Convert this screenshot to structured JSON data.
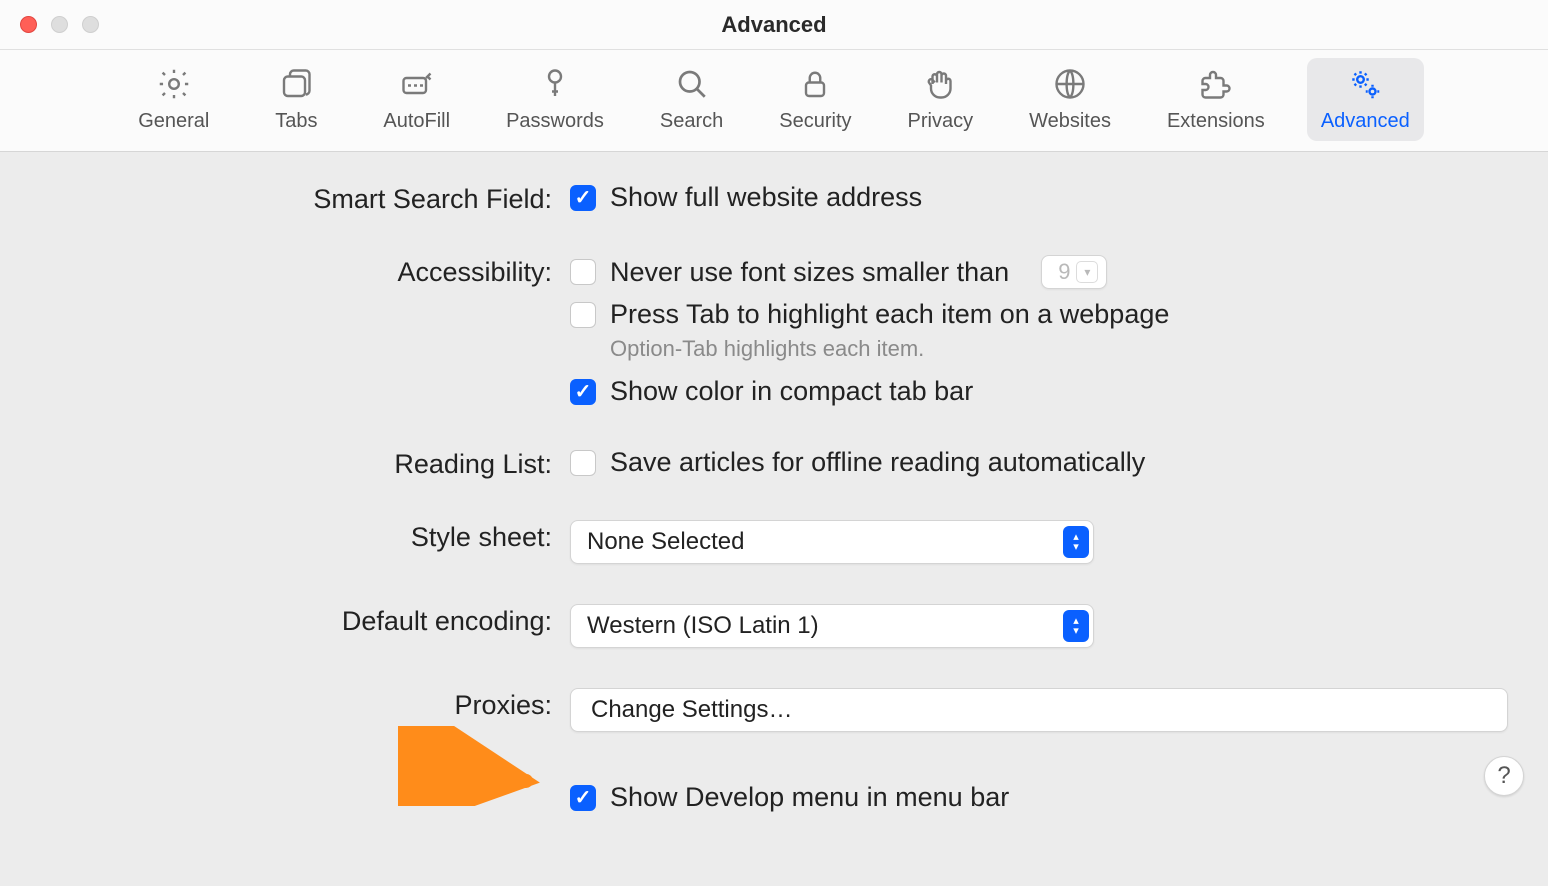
{
  "window": {
    "title": "Advanced"
  },
  "toolbar": {
    "items": [
      {
        "label": "General"
      },
      {
        "label": "Tabs"
      },
      {
        "label": "AutoFill"
      },
      {
        "label": "Passwords"
      },
      {
        "label": "Search"
      },
      {
        "label": "Security"
      },
      {
        "label": "Privacy"
      },
      {
        "label": "Websites"
      },
      {
        "label": "Extensions"
      },
      {
        "label": "Advanced"
      }
    ],
    "active": "Advanced"
  },
  "sections": {
    "smart_search": {
      "label": "Smart Search Field:",
      "show_full_address": {
        "checked": true,
        "text": "Show full website address"
      }
    },
    "accessibility": {
      "label": "Accessibility:",
      "min_font": {
        "checked": false,
        "text": "Never use font sizes smaller than",
        "value": "9"
      },
      "tab_highlight": {
        "checked": false,
        "text": "Press Tab to highlight each item on a webpage"
      },
      "tab_hint": "Option-Tab highlights each item.",
      "compact_color": {
        "checked": true,
        "text": "Show color in compact tab bar"
      }
    },
    "reading_list": {
      "label": "Reading List:",
      "offline": {
        "checked": false,
        "text": "Save articles for offline reading automatically"
      }
    },
    "style_sheet": {
      "label": "Style sheet:",
      "value": "None Selected"
    },
    "default_encoding": {
      "label": "Default encoding:",
      "value": "Western (ISO Latin 1)"
    },
    "proxies": {
      "label": "Proxies:",
      "button": "Change Settings…"
    },
    "develop": {
      "checked": true,
      "text": "Show Develop menu in menu bar"
    }
  },
  "help": "?"
}
